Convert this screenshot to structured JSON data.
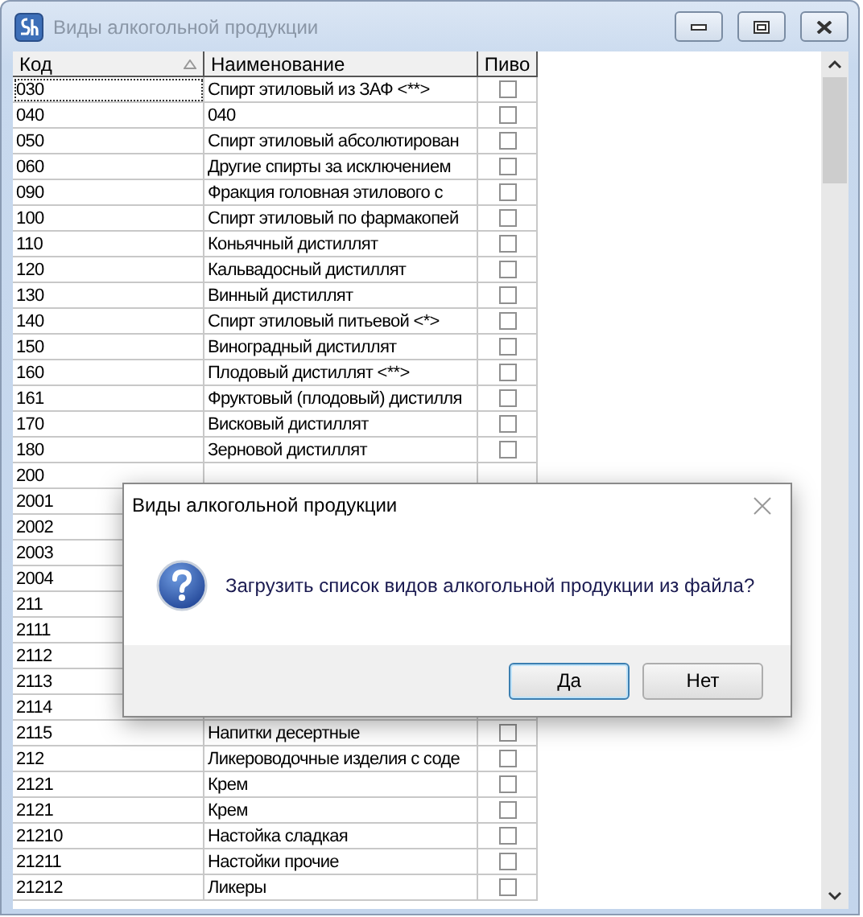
{
  "window": {
    "title": "Виды алкогольной продукции"
  },
  "table": {
    "columns": [
      "Код",
      "Наименование",
      "Пиво"
    ],
    "rows": [
      {
        "code": "030",
        "name": "Спирт этиловый из ЗАФ <**>",
        "beer": false,
        "selected": true
      },
      {
        "code": "040",
        "name": "040",
        "beer": false,
        "selected": false
      },
      {
        "code": "050",
        "name": "Спирт этиловый абсолютирован",
        "beer": false,
        "selected": false
      },
      {
        "code": "060",
        "name": "Другие спирты за исключением",
        "beer": false,
        "selected": false
      },
      {
        "code": "090",
        "name": "Фракция головная этилового с",
        "beer": false,
        "selected": false
      },
      {
        "code": "100",
        "name": "Спирт этиловый по фармакопей",
        "beer": false,
        "selected": false
      },
      {
        "code": "110",
        "name": "Коньячный дистиллят",
        "beer": false,
        "selected": false
      },
      {
        "code": "120",
        "name": "Кальвадосный дистиллят",
        "beer": false,
        "selected": false
      },
      {
        "code": "130",
        "name": "Винный дистиллят",
        "beer": false,
        "selected": false
      },
      {
        "code": "140",
        "name": "Спирт этиловый питьевой <*>",
        "beer": false,
        "selected": false
      },
      {
        "code": "150",
        "name": "Виноградный дистиллят",
        "beer": false,
        "selected": false
      },
      {
        "code": "160",
        "name": "Плодовый дистиллят <**>",
        "beer": false,
        "selected": false
      },
      {
        "code": "161",
        "name": "Фруктовый (плодовый) дистилля",
        "beer": false,
        "selected": false
      },
      {
        "code": "170",
        "name": "Висковый дистиллят",
        "beer": false,
        "selected": false
      },
      {
        "code": "180",
        "name": "Зерновой дистиллят",
        "beer": false,
        "selected": false
      },
      {
        "code": "200",
        "selected": false
      },
      {
        "code": "2001",
        "selected": false
      },
      {
        "code": "2002",
        "selected": false
      },
      {
        "code": "2003",
        "selected": false
      },
      {
        "code": "2004",
        "selected": false
      },
      {
        "code": "211",
        "selected": false
      },
      {
        "code": "2111",
        "selected": false
      },
      {
        "code": "2112",
        "selected": false
      },
      {
        "code": "2113",
        "selected": false
      },
      {
        "code": "2114",
        "selected": false
      },
      {
        "code": "2115",
        "name": "Напитки десертные",
        "beer": false,
        "selected": false
      },
      {
        "code": "212",
        "name": "Ликероводочные изделия с соде",
        "beer": false,
        "selected": false
      },
      {
        "code": "2121",
        "name": "Крем",
        "beer": false,
        "selected": false
      },
      {
        "code": "2121",
        "name": "Крем",
        "beer": false,
        "selected": false
      },
      {
        "code": "21210",
        "name": "Настойка сладкая",
        "beer": false,
        "selected": false
      },
      {
        "code": "21211",
        "name": "Настойки прочие",
        "beer": false,
        "selected": false
      },
      {
        "code": "21212",
        "name": "Ликеры",
        "beer": false,
        "selected": false
      }
    ]
  },
  "dialog": {
    "title": "Виды алкогольной продукции",
    "message": "Загрузить список видов алкогольной продукции из файла?",
    "buttons": [
      {
        "label": "Да",
        "default": true
      },
      {
        "label": "Нет",
        "default": false
      }
    ]
  }
}
